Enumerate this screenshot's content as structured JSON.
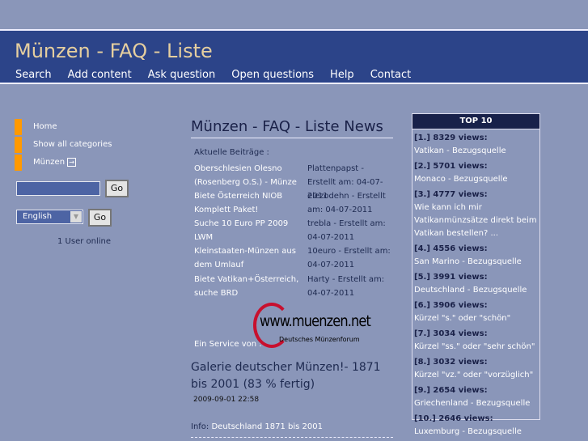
{
  "header": {
    "title": "Münzen - FAQ - Liste",
    "nav": [
      "Search",
      "Add content",
      "Ask question",
      "Open questions",
      "Help",
      "Contact"
    ]
  },
  "sidebar": {
    "items": [
      "Home",
      "Show all categories",
      "Münzen"
    ],
    "search_value": "",
    "go": "Go",
    "language": "English",
    "users_online": "1 User online"
  },
  "main": {
    "title": "Münzen - FAQ - Liste News",
    "recent_label": "Aktuelle Beiträge :",
    "posts": [
      {
        "title": "Oberschlesien Olesno (Rosenberg O.S.) - Münze",
        "meta": "Plattenpapst - Erstellt am: 04-07-2011"
      },
      {
        "title": "Biete Österreich NIOB Komplett Paket!",
        "meta": "elezodehn - Erstellt am: 04-07-2011"
      },
      {
        "title": "Suche 10 Euro PP 2009 LWM",
        "meta": "trebla - Erstellt am: 04-07-2011"
      },
      {
        "title": "Kleinstaaten-Münzen aus dem Umlauf",
        "meta": "10euro - Erstellt am: 04-07-2011"
      },
      {
        "title": "Biete Vatikan+Österreich, suche BRD",
        "meta": "Harty - Erstellt am: 04-07-2011"
      }
    ],
    "service_label": "Ein Service von :",
    "logo_text": "www.muenzen.net",
    "logo_sub": "Deutsches Münzenforum",
    "news_title": "Galerie deutscher Münzen!- 1871 bis 2001 (83 % fertig)",
    "news_date": "2009-09-01 22:58",
    "info_label": "Info:",
    "info_link": "Deutschland 1871 bis 2001"
  },
  "top10": {
    "title": "TOP 10",
    "items": [
      {
        "rank": "[1.] 8329 views:",
        "q": "Vatikan - Bezugsquelle"
      },
      {
        "rank": "[2.] 5701 views:",
        "q": "Monaco - Bezugsquelle"
      },
      {
        "rank": "[3.] 4777 views:",
        "q": "Wie kann ich mir Vatikanmünzsätze direkt beim Vatikan bestellen? ..."
      },
      {
        "rank": "[4.] 4556 views:",
        "q": "San Marino - Bezugsquelle"
      },
      {
        "rank": "[5.] 3991 views:",
        "q": "Deutschland - Bezugsquelle"
      },
      {
        "rank": "[6.] 3906 views:",
        "q": "Kürzel \"s.\" oder \"schön\""
      },
      {
        "rank": "[7.] 3034 views:",
        "q": "Kürzel \"ss.\" oder \"sehr schön\""
      },
      {
        "rank": "[8.] 3032 views:",
        "q": "Kürzel \"vz.\" oder \"vorzüglich\""
      },
      {
        "rank": "[9.] 2654 views:",
        "q": "Griechenland - Bezugsquelle"
      },
      {
        "rank": "[10.] 2646 views:",
        "q": "Luxemburg - Bezugsquelle"
      }
    ]
  }
}
